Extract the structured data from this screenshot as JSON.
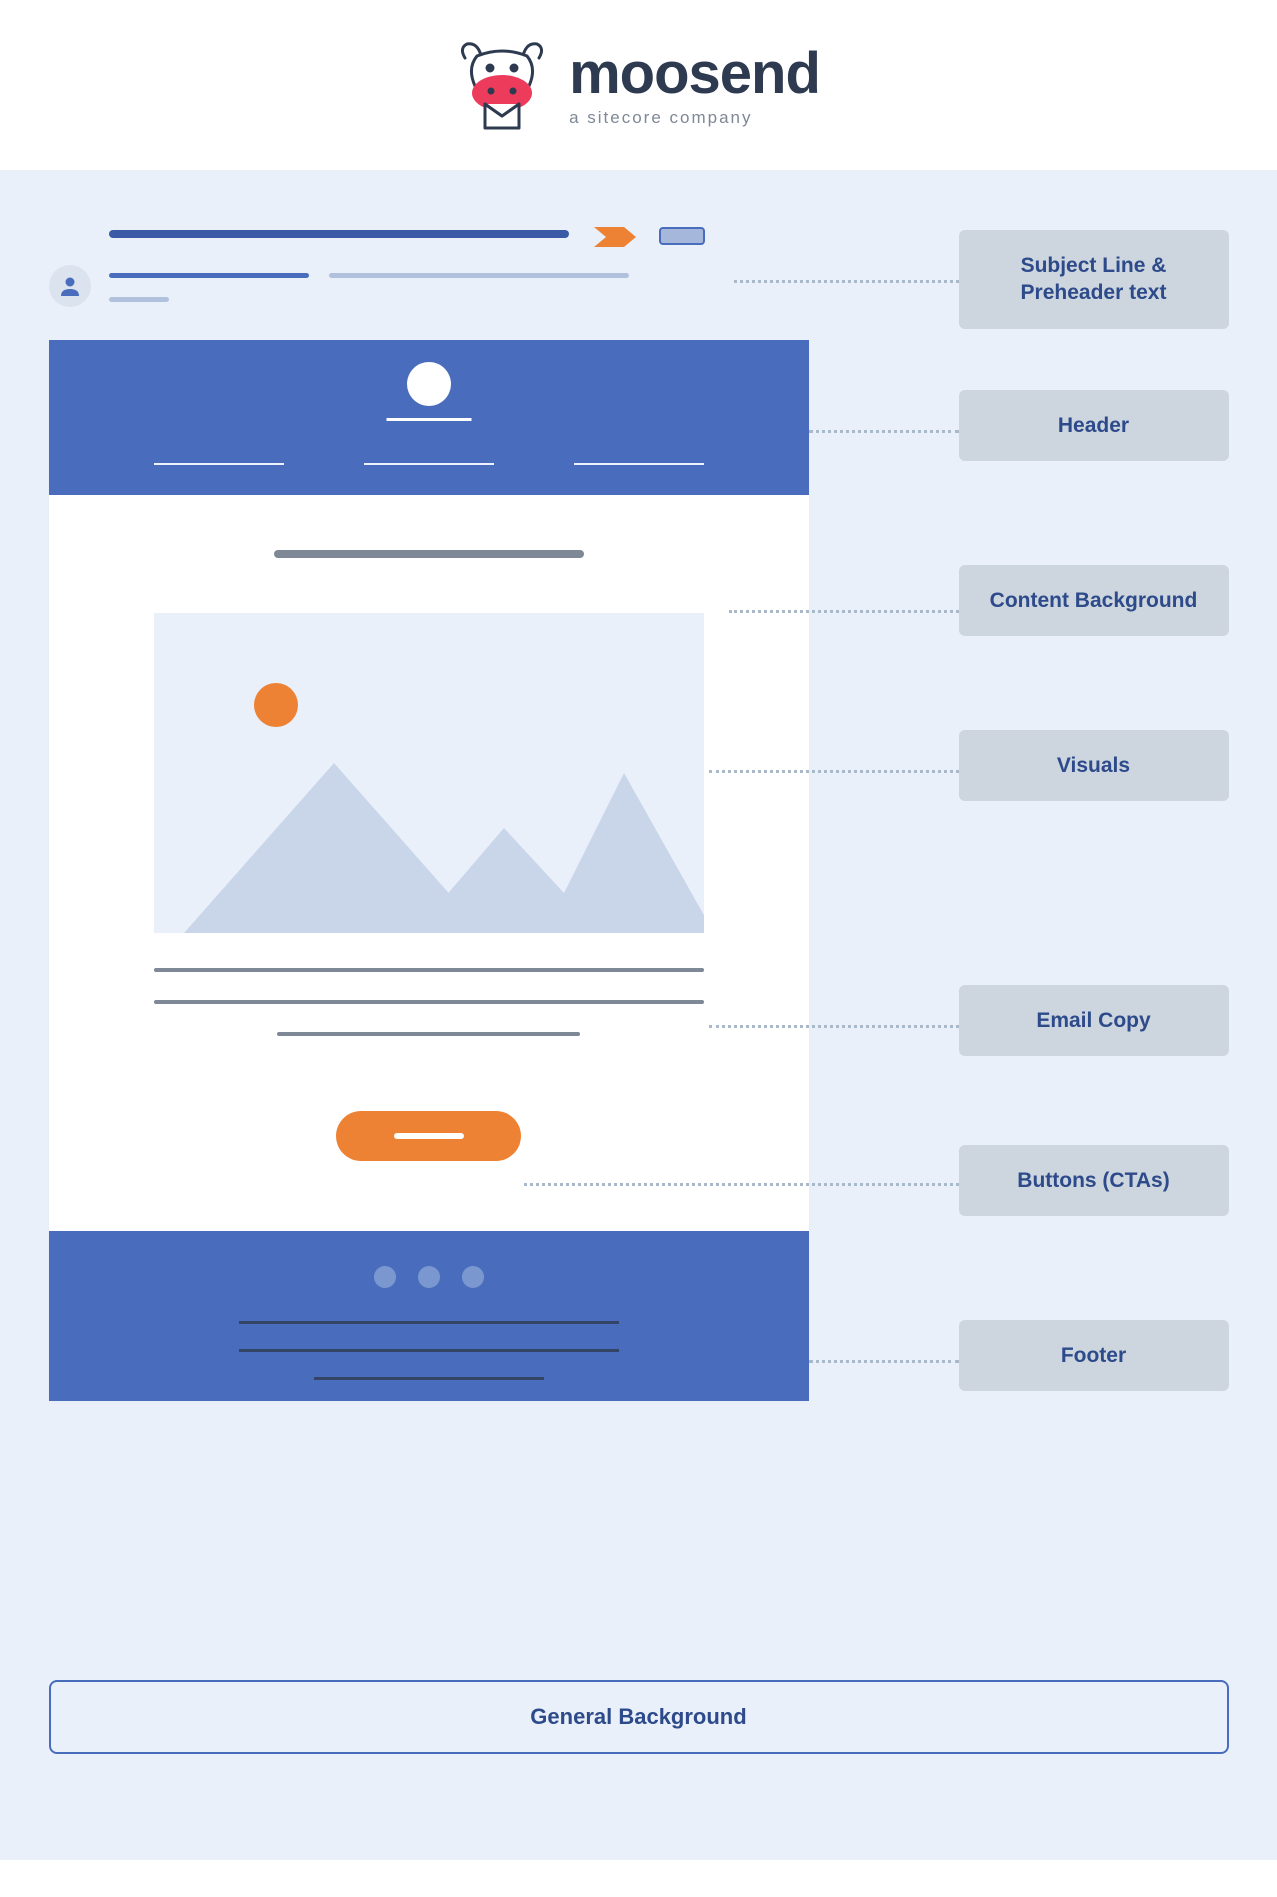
{
  "brand": {
    "name": "moosend",
    "tagline": "a sitecore company"
  },
  "labels": {
    "subject": "Subject Line & Preheader text",
    "header": "Header",
    "content_bg": "Content Background",
    "visuals": "Visuals",
    "copy": "Email Copy",
    "cta": "Buttons (CTAs)",
    "footer": "Footer",
    "general": "General Background"
  }
}
